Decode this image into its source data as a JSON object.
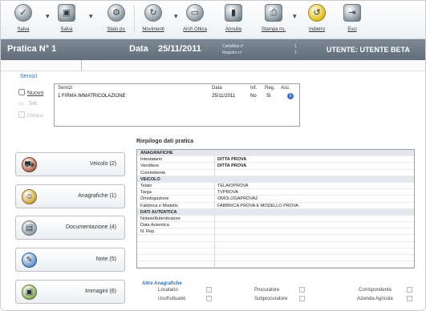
{
  "toolbar": {
    "buttons": [
      {
        "label": "Salva",
        "icon": "save-icon",
        "glyph": "✓"
      },
      {
        "label": "Salva",
        "icon": "save-as-icon",
        "glyph": "▣"
      },
      {
        "label": "Stato pv.",
        "icon": "status-icon",
        "glyph": "⚙"
      },
      {
        "label": "Movimenti",
        "icon": "movements-icon",
        "glyph": "↻"
      },
      {
        "label": "Arch.Ottica",
        "icon": "archive-icon",
        "glyph": "▭"
      },
      {
        "label": "Annulla",
        "icon": "cancel-icon",
        "glyph": "▮"
      },
      {
        "label": "Stampa ris.",
        "icon": "print-icon",
        "glyph": "⎙"
      },
      {
        "label": "Indietro",
        "icon": "back-icon",
        "glyph": "↺"
      },
      {
        "label": "Esci",
        "icon": "exit-icon",
        "glyph": "⇥"
      }
    ]
  },
  "titlebar": {
    "pratica": "Pratica N° 1",
    "data_label": "Data",
    "data_value": "25/11/2011",
    "cartellina_label": "Cartellina n°",
    "cartellina_value": "1",
    "registro_label": "Registro n°",
    "registro_value": "1",
    "utente": "UTENTE: UTENTE BETA"
  },
  "servizi": {
    "title": "Servizi",
    "actions": [
      "Nuovo",
      "Sel.",
      "Elimina"
    ],
    "headers": [
      "Servizi",
      "Data",
      "Inf.",
      "Reg.",
      "Ass."
    ],
    "rows": [
      {
        "servizio": "1 FIRMA IMMATRICOLAZIONE",
        "data": "25/11/2011",
        "inf": "No",
        "reg": "Sì",
        "ass": "i"
      }
    ]
  },
  "left_buttons": [
    {
      "label": "Veicolo (2)",
      "icon": "car-icon",
      "glyph": "⛟"
    },
    {
      "label": "Anagrafiche (1)",
      "icon": "person-icon",
      "glyph": "☺"
    },
    {
      "label": "Documentazione (4)",
      "icon": "documents-icon",
      "glyph": "▤"
    },
    {
      "label": "Note (5)",
      "icon": "notes-icon",
      "glyph": "✎"
    },
    {
      "label": "Immagini (6)",
      "icon": "images-icon",
      "glyph": "▣"
    }
  ],
  "riepilogo": {
    "title": "Riepilogo dati pratica",
    "rows": [
      {
        "section": true,
        "k": "ANAGRAFICHE",
        "v": ""
      },
      {
        "k": "Intestatario",
        "v": "DITTA PROVA",
        "bold": true
      },
      {
        "k": "Venditore",
        "v": "DITTA PROVA",
        "bold": true
      },
      {
        "k": "Committente",
        "v": ""
      },
      {
        "section": true,
        "k": "VEICOLO",
        "v": ""
      },
      {
        "k": "Telaio",
        "v": "TELAIOPROVA"
      },
      {
        "k": "Targa",
        "v": "TVPROVA"
      },
      {
        "k": "Omologazione",
        "v": "OMOLOGAPROVA2"
      },
      {
        "k": "Fabbrica e Modello",
        "v": "FABBRICA PROVA E MODELLO PROVA"
      },
      {
        "section": true,
        "k": "DATI AUTENTICA",
        "v": ""
      },
      {
        "k": "Notaio/Autenticatore",
        "v": ""
      },
      {
        "k": "Data Autentica",
        "v": ""
      },
      {
        "k": "N. Rep.",
        "v": ""
      },
      {
        "k": "",
        "v": ""
      },
      {
        "k": "",
        "v": ""
      },
      {
        "k": "",
        "v": ""
      },
      {
        "k": "",
        "v": ""
      },
      {
        "k": "",
        "v": ""
      }
    ]
  },
  "altre_anagrafiche": {
    "title": "Altre Anagrafiche",
    "items": [
      "Locatario",
      "Usufruttuario",
      "Procuratore",
      "Subprocuratore",
      "Corrispondente",
      "Azienda Agricola"
    ]
  }
}
